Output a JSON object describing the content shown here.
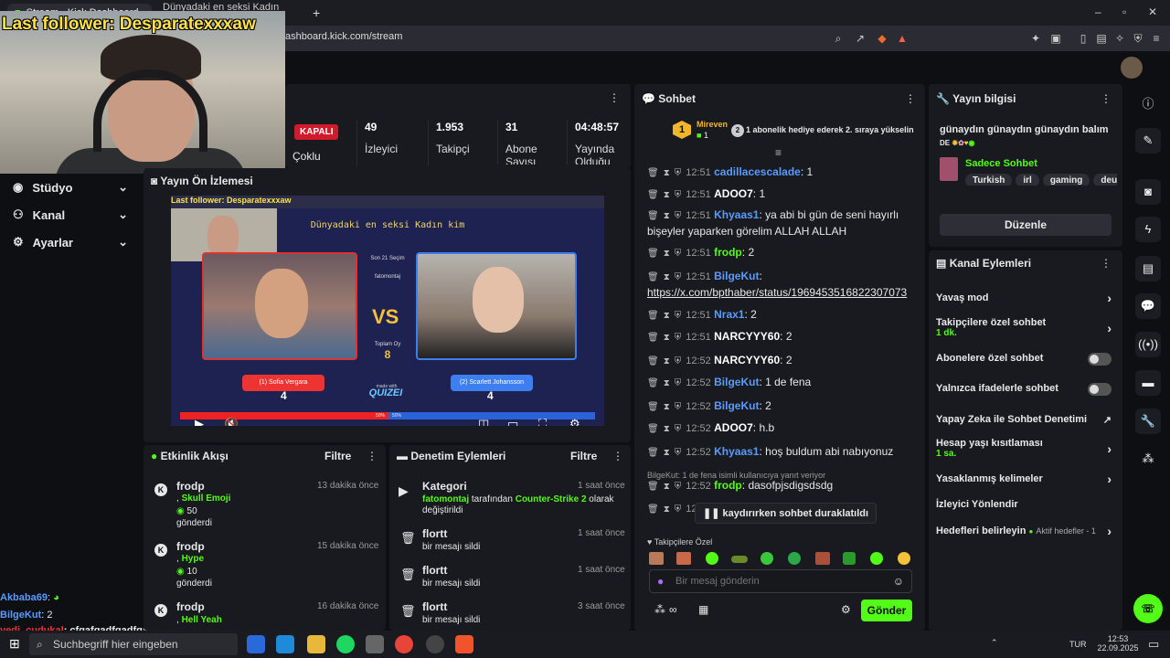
{
  "browser": {
    "tabs": [
      "Stream - Kick Dashboard",
      "Dünyadaki en seksi Kadın kim - Quiz"
    ],
    "url": "ashboard.kick.com/stream"
  },
  "overlay": {
    "last_follower": "Last follower: Desparatexxxaw"
  },
  "nav": {
    "items": [
      {
        "label": "Stüdyo"
      },
      {
        "label": "Kanal"
      },
      {
        "label": "Ayarlar"
      }
    ]
  },
  "stats": {
    "status": "KAPALI",
    "status_label": "Çoklu",
    "items": [
      {
        "value": "49",
        "label": "İzleyici"
      },
      {
        "value": "1.953",
        "label": "Takipçi"
      },
      {
        "value": "31",
        "label": "Abone Sayısı"
      },
      {
        "value": "04:48:57",
        "label": "Yayında Olduğu"
      }
    ]
  },
  "preview": {
    "title": "Yayın Ön İzlemesi",
    "quiz_title": "Dünyadaki en seksi Kadın kim",
    "overlay_text": "Last follower: Desparatexxxaw",
    "left_label": "(1) Sofia Vergara",
    "right_label": "(2) Scarlett Johansson",
    "left_score": "4",
    "right_score": "4",
    "mid_top": "Son 21 Seçim",
    "mid_user": "fatomontaj",
    "total_label": "Toplam Oy",
    "total": "8",
    "vs": "VS",
    "brand": "QUIZEI",
    "made_with": "made with",
    "left_pct": "50%",
    "right_pct": "50%"
  },
  "events": {
    "title": "Etkinlik Akışı",
    "filter": "Filtre",
    "items": [
      {
        "user": "frodp",
        "item": "Skull Emoji",
        "amount": "50",
        "verb": "gönderdi",
        "time": "13 dakika önce"
      },
      {
        "user": "frodp",
        "item": "Hype",
        "amount": "10",
        "verb": "gönderdi",
        "time": "15 dakika önce"
      },
      {
        "user": "frodp",
        "item": "Hell Yeah",
        "amount": "",
        "verb": "",
        "time": "16 dakika önce"
      }
    ]
  },
  "moderation": {
    "title": "Denetim Eylemleri",
    "filter": "Filtre",
    "items": [
      {
        "title": "Kategori",
        "actor": "fatomontaj",
        "mid": "tarafından",
        "target": "Counter-Strike 2",
        "rest": "olarak değiştirildi",
        "time": "1 saat önce"
      },
      {
        "title": "flortt",
        "desc": "bir mesajı sildi",
        "time": "1 saat önce"
      },
      {
        "title": "flortt",
        "desc": "bir mesajı sildi",
        "time": "1 saat önce"
      },
      {
        "title": "flortt",
        "desc": "bir mesajı sildi",
        "time": "3 saat önce"
      }
    ]
  },
  "chat": {
    "title": "Sohbet",
    "pinned_user": "Mireven",
    "pinned_count": "1",
    "pinned_rank": "1",
    "pinned_badge": "2",
    "pinned_text": "1 abonelik hediye ederek 2. sıraya yükselin",
    "messages": [
      {
        "time": "12:51",
        "user": "cadillacescalade",
        "color": "blue",
        "text": "1"
      },
      {
        "time": "12:51",
        "user": "ADOO7",
        "color": "white",
        "text": "1"
      },
      {
        "time": "12:51",
        "user": "Khyaas1",
        "color": "blue",
        "text": "ya abi bi gün de seni hayırlı bişeyler yaparken görelim ALLAH ALLAH"
      },
      {
        "time": "12:51",
        "user": "frodp",
        "color": "green",
        "text": "2"
      },
      {
        "time": "12:51",
        "user": "BilgeKut",
        "color": "blue",
        "text": "https://x.com/bpthaber/status/1969453516822307073"
      },
      {
        "time": "12:51",
        "user": "Nrax1",
        "color": "blue",
        "text": "2"
      },
      {
        "time": "12:51",
        "user": "NARCYYY60",
        "color": "white",
        "text": "2"
      },
      {
        "time": "12:52",
        "user": "NARCYYY60",
        "color": "white",
        "text": "2"
      },
      {
        "time": "12:52",
        "user": "BilgeKut",
        "color": "blue",
        "text": "1 de fena"
      },
      {
        "time": "12:52",
        "user": "BilgeKut",
        "color": "blue",
        "text": "2"
      },
      {
        "time": "12:52",
        "user": "ADOO7",
        "color": "white",
        "text": "h.b"
      },
      {
        "time": "12:52",
        "user": "Khyaas1",
        "color": "blue",
        "text": "hoş buldum abi nabıyonuz"
      },
      {
        "time": "12:52",
        "user": "frodp",
        "color": "green",
        "text": "dasofpjsdigsdsdg"
      },
      {
        "time": "12:52",
        "user": "",
        "color": "white",
        "text": "mir"
      }
    ],
    "reply_note": "BilgeKut: 1 de fena isimli kullanıcıya yanıt veriyor",
    "paused": "kaydırırken sohbet duraklatıldı",
    "follower_mode": "Takipçilere Özel",
    "placeholder": "Bir mesaj gönderin",
    "send": "Gönder"
  },
  "stream_info": {
    "title_label": "Yayın bilgisi",
    "stream_title": "günaydın günaydın günaydın balım",
    "lang": "DE",
    "category": "Sadece Sohbet",
    "tags": [
      "Turkish",
      "irl",
      "gaming",
      "deutsc"
    ],
    "edit": "Düzenle"
  },
  "channel_actions": {
    "title": "Kanal Eylemleri",
    "items": [
      {
        "label": "Yavaş mod",
        "sub": "",
        "control": "chevron"
      },
      {
        "label": "Takipçilere özel sohbet",
        "sub": "1 dk.",
        "control": "chevron"
      },
      {
        "label": "Abonelere özel sohbet",
        "sub": "",
        "control": "toggle"
      },
      {
        "label": "Yalnızca ifadelerle sohbet",
        "sub": "",
        "control": "toggle"
      },
      {
        "label": "Yapay Zeka ile Sohbet Denetimi",
        "sub": "",
        "control": "external"
      },
      {
        "label": "Hesap yaşı kısıtlaması",
        "sub": "1 sa.",
        "control": "chevron"
      },
      {
        "label": "Yasaklanmış kelimeler",
        "sub": "",
        "control": "chevron"
      },
      {
        "label": "İzleyici Yönlendir",
        "sub": "",
        "control": "none"
      },
      {
        "label": "Hedefleri belirleyin",
        "sub": "Aktif hedefler - 1",
        "control": "chevron"
      }
    ]
  },
  "left_chat": {
    "lines": [
      {
        "user": "Akbaba69",
        "text": ":"
      },
      {
        "user": "BilgeKut",
        "text": ": 2"
      },
      {
        "user": "yedi_cudukal",
        "text": ": cfgafgadfgadfgagagadfs"
      }
    ]
  },
  "taskbar": {
    "search": "Suchbegriff hier eingeben",
    "lang": "TUR",
    "time": "12:53",
    "date": "22.09.2025"
  },
  "colors": {
    "accent": "#53fc18",
    "live_red": "#d11a2a",
    "username_blue": "#5b9bff"
  }
}
